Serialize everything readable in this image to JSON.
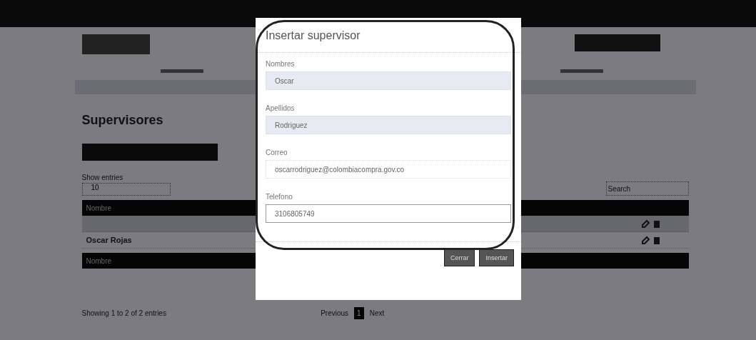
{
  "page": {
    "heading": "Supervisores",
    "show_entries_label": "Show entries",
    "page_size": "10",
    "search": {
      "placeholder": "Search"
    },
    "table": {
      "header": "Nombre",
      "footer": "Nombre",
      "rows": [
        {
          "name": "",
          "shaded": true
        },
        {
          "name": "Oscar Rojas",
          "shaded": false
        }
      ]
    },
    "info": "Showing 1 to 2 of 2 entries",
    "pagination": [
      {
        "label": "Previous",
        "selected": false
      },
      {
        "label": "1",
        "selected": true
      },
      {
        "label": "Next",
        "selected": false
      }
    ]
  },
  "modal": {
    "title": "Insertar supervisor",
    "fields": [
      {
        "label": "Nombres",
        "value": "Oscar",
        "disabled": true,
        "focused": false
      },
      {
        "label": "Apellidos",
        "value": "Rodriguez",
        "disabled": true,
        "focused": false
      },
      {
        "label": "Correo",
        "value": "oscarrodriguez@colombiacompra.gov.co",
        "disabled": false,
        "focused": false
      },
      {
        "label": "Telefono",
        "value": "3106805749",
        "disabled": false,
        "focused": true
      }
    ],
    "buttons": [
      "Cerrar",
      "Insertar"
    ]
  }
}
